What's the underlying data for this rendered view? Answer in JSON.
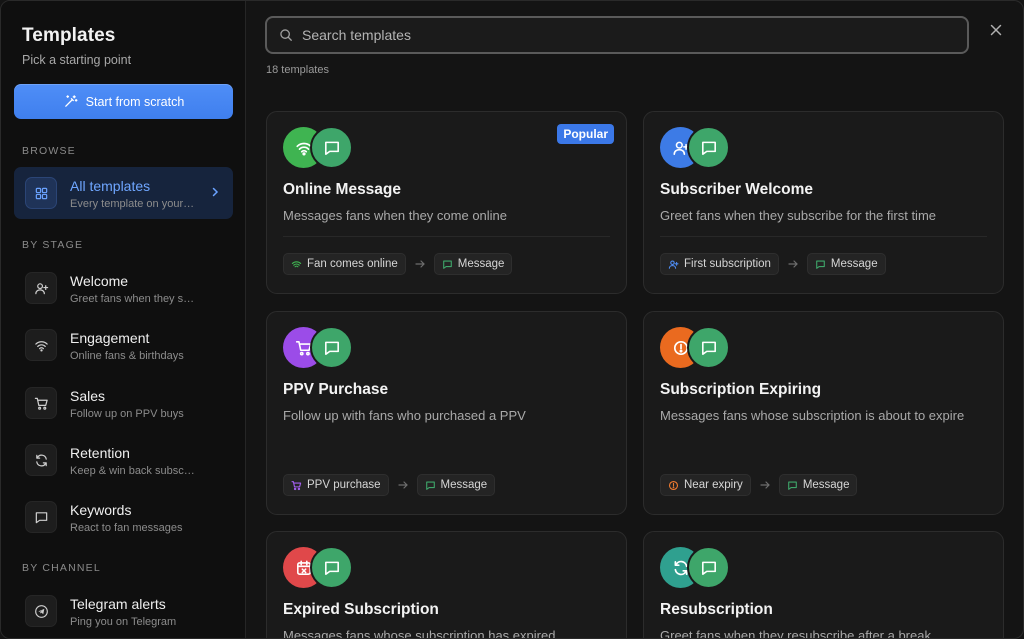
{
  "sidebar": {
    "title": "Templates",
    "subtitle": "Pick a starting point",
    "scratch_label": "Start from scratch",
    "browse_label": "BROWSE",
    "stage_label": "BY STAGE",
    "channel_label": "BY CHANNEL",
    "all": {
      "label": "All templates",
      "desc": "Every template on your account"
    },
    "items": [
      {
        "label": "Welcome",
        "desc": "Greet fans when they subscribe",
        "icon": "user-plus-icon"
      },
      {
        "label": "Engagement",
        "desc": "Online fans & birthdays",
        "icon": "wifi-icon"
      },
      {
        "label": "Sales",
        "desc": "Follow up on PPV buys",
        "icon": "cart-icon"
      },
      {
        "label": "Retention",
        "desc": "Keep & win back subscribers",
        "icon": "refresh-icon"
      },
      {
        "label": "Keywords",
        "desc": "React to fan messages",
        "icon": "message-icon"
      }
    ],
    "channel": {
      "label": "Telegram alerts",
      "desc": "Ping you on Telegram",
      "icon": "telegram-icon"
    }
  },
  "search": {
    "placeholder": "Search templates"
  },
  "count": "18 templates",
  "colors": {
    "accent": "#3b78e8",
    "message_green": "#3ea66a",
    "wifi_green": "#3fb451",
    "user_blue": "#3d7be6",
    "cart_purple": "#9b4ce8",
    "expiry_orange": "#ea6a1f",
    "expired_red": "#e0484a",
    "resub_teal": "#2fa08f"
  },
  "cards": [
    {
      "title": "Online Message",
      "desc": "Messages fans when they come online",
      "badge": "Popular",
      "trigger": "Fan comes online",
      "action": "Message"
    },
    {
      "title": "Subscriber Welcome",
      "desc": "Greet fans when they subscribe for the first time",
      "trigger": "First subscription",
      "action": "Message"
    },
    {
      "title": "PPV Purchase",
      "desc": "Follow up with fans who purchased a PPV",
      "trigger": "PPV purchase",
      "action": "Message"
    },
    {
      "title": "Subscription Expiring",
      "desc": "Messages fans whose subscription is about to expire",
      "trigger": "Near expiry",
      "action": "Message"
    },
    {
      "title": "Expired Subscription",
      "desc": "Messages fans whose subscription has expired"
    },
    {
      "title": "Resubscription",
      "desc": "Greet fans when they resubscribe after a break"
    }
  ]
}
